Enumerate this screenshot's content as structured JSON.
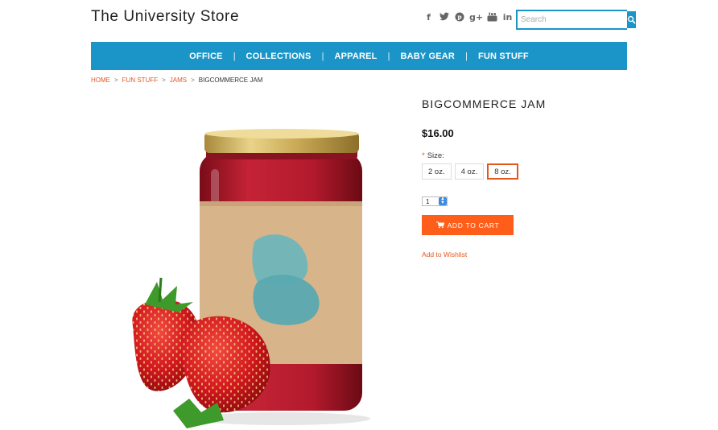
{
  "header": {
    "store_title": "The University Store",
    "search": {
      "placeholder": "Search"
    },
    "social_icons": [
      "facebook-icon",
      "twitter-icon",
      "pinterest-icon",
      "google-plus-icon",
      "youtube-icon",
      "linkedin-icon"
    ]
  },
  "nav": {
    "items": [
      "OFFICE",
      "COLLECTIONS",
      "APPAREL",
      "BABY GEAR",
      "FUN STUFF"
    ]
  },
  "breadcrumb": {
    "items": [
      "HOME",
      "FUN STUFF",
      "JAMS"
    ],
    "current": "BIGCOMMERCE JAM",
    "separator": ">"
  },
  "product": {
    "title": "BIGCOMMERCE JAM",
    "price": "$16.00",
    "size_required_mark": "*",
    "size_label": "Size:",
    "sizes": [
      "2 oz.",
      "4 oz.",
      "8 oz."
    ],
    "selected_size": "8 oz.",
    "quantity": "1",
    "add_to_cart_label": "ADD TO CART",
    "wishlist_label": "Add to Wishlist"
  },
  "colors": {
    "brand_blue": "#1b95c7",
    "accent_orange": "#fe5e1a",
    "link_orange": "#e2571e"
  }
}
